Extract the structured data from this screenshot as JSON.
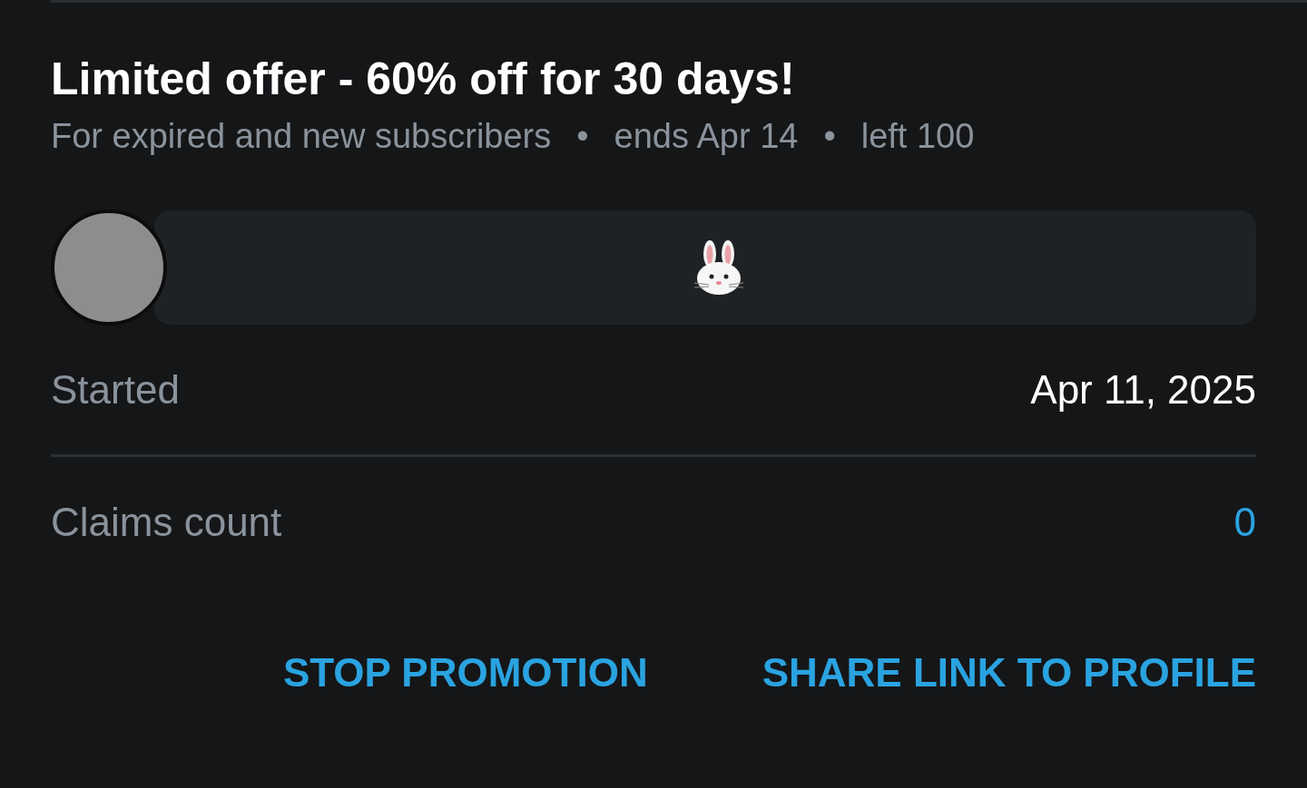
{
  "offer": {
    "title": "Limited offer - 60% off for 30 days!",
    "meta": [
      "For expired and new subscribers",
      "ends Apr 14",
      "left 100"
    ],
    "separator": "•"
  },
  "details": [
    {
      "label": "Started",
      "value": "Apr 11, 2025",
      "kind": "plain"
    },
    {
      "label": "Claims count",
      "value": "0",
      "kind": "link"
    }
  ],
  "buttons": [
    "STOP PROMOTION",
    "SHARE LINK TO PROFILE"
  ]
}
